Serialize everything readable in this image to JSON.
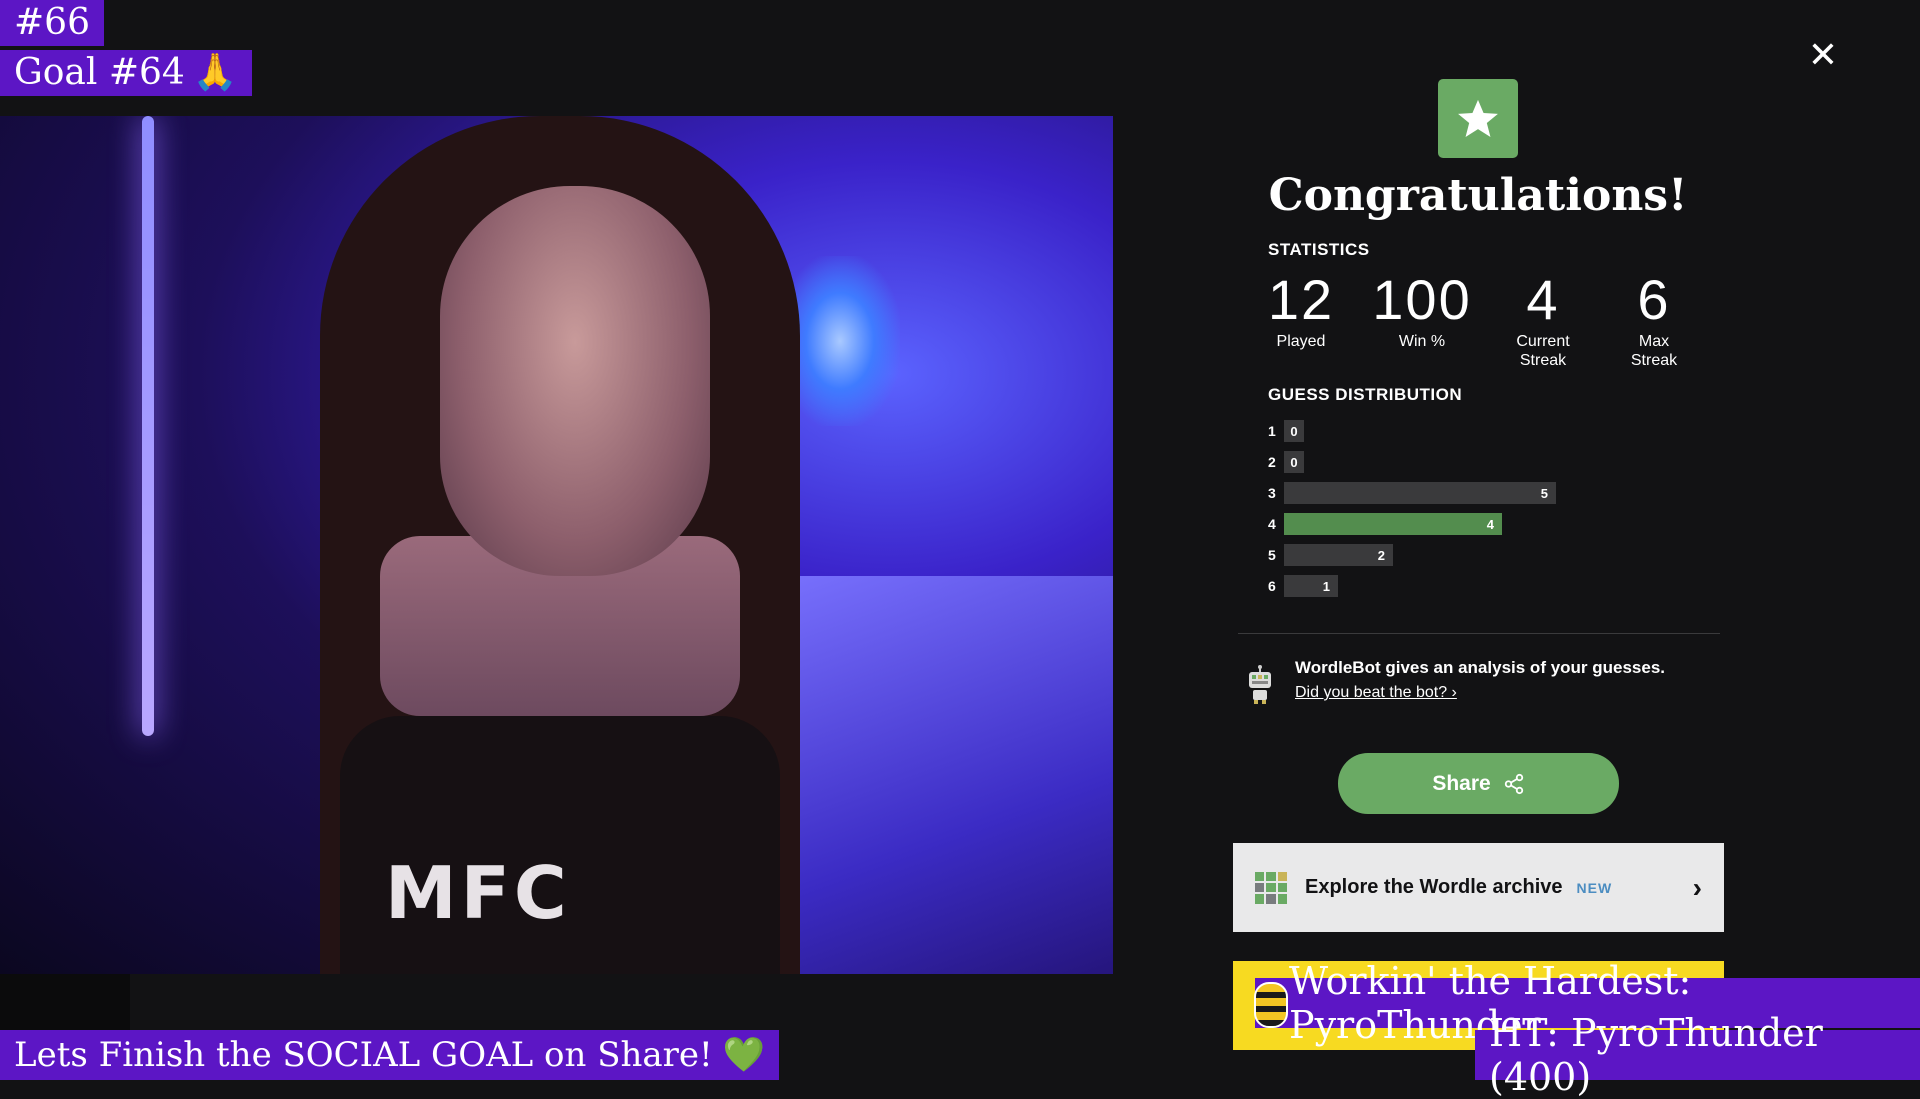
{
  "stream_overlay": {
    "count_text": "#66",
    "goal_text": "Goal #64",
    "goal_emoji": "🙏",
    "bottom_text": "Lets Finish the SOCIAL GOAL on Share!",
    "bottom_emoji": "💚",
    "working_banner": "Workin' the Hardest: PyroThunder",
    "ht_banner": "HT: PyroThunder (400)"
  },
  "webcam": {
    "shirt_logo": "MFC"
  },
  "modal": {
    "close_icon": "✕",
    "icon": "star-icon",
    "title": "Congratulations!",
    "statistics_label": "STATISTICS",
    "stats": [
      {
        "value": "12",
        "label": "Played"
      },
      {
        "value": "100",
        "label": "Win %"
      },
      {
        "value": "4",
        "label": "Current Streak"
      },
      {
        "value": "6",
        "label": "Max Streak"
      }
    ],
    "distribution_label": "GUESS DISTRIBUTION",
    "distribution": [
      {
        "guess": "1",
        "count": 0,
        "fraction": 0.0,
        "highlight": false
      },
      {
        "guess": "2",
        "count": 0,
        "fraction": 0.0,
        "highlight": false
      },
      {
        "guess": "3",
        "count": 5,
        "fraction": 1.0,
        "highlight": false
      },
      {
        "guess": "4",
        "count": 4,
        "fraction": 0.8,
        "highlight": true
      },
      {
        "guess": "5",
        "count": 2,
        "fraction": 0.4,
        "highlight": false
      },
      {
        "guess": "6",
        "count": 1,
        "fraction": 0.2,
        "highlight": false
      }
    ],
    "wordlebot_text": "WordleBot gives an analysis of your guesses.",
    "wordlebot_link": "Did you beat the bot? ›",
    "share_label": "Share",
    "archive_text": "Explore the Wordle archive",
    "archive_badge": "NEW",
    "colors": {
      "accent_green": "#6aaa64",
      "bar_green": "#538d4e",
      "bar_gray": "#3a3a3c",
      "overlay_purple": "#5c16c5",
      "card_yellow": "#f7da21"
    }
  }
}
